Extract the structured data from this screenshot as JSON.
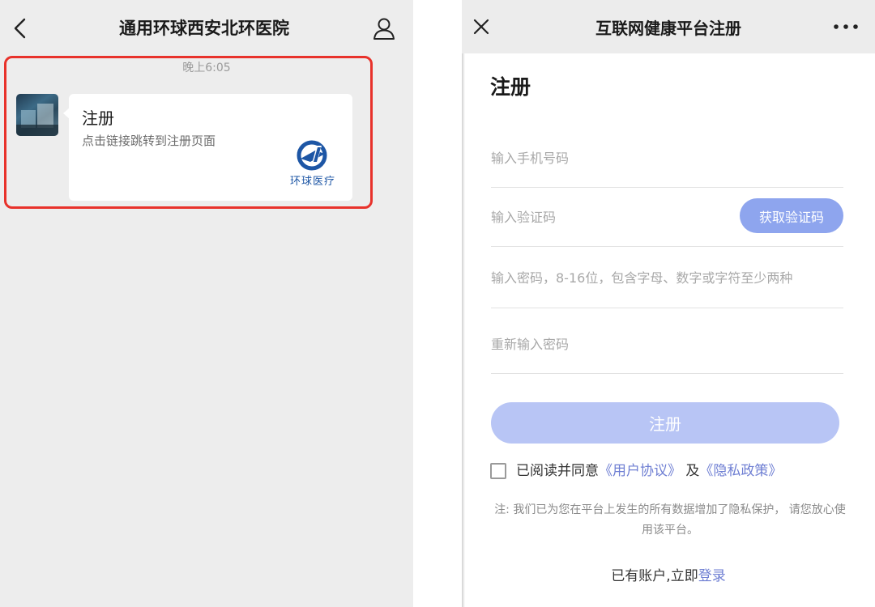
{
  "chat": {
    "header_title": "通用环球西安北环医院",
    "time": "晚上6:05",
    "card": {
      "title": "注册",
      "description": "点击链接跳转到注册页面",
      "logo_text": "环球医疗"
    }
  },
  "register": {
    "header_title": "互联网健康平台注册",
    "heading": "注册",
    "fields": {
      "phone_placeholder": "输入手机号码",
      "code_placeholder": "输入验证码",
      "password_placeholder": "输入密码，8-16位，包含字母、数字或字符至少两种",
      "confirm_placeholder": "重新输入密码"
    },
    "get_code_label": "获取验证码",
    "submit_label": "注册",
    "agreement": {
      "prefix": "已阅读并同意",
      "user_agreement": "《用户协议》",
      "conjunction": " 及",
      "privacy_policy": "《隐私政策》",
      "checked": false
    },
    "privacy_note": "注: 我们已为您在平台上发生的所有数据增加了隐私保护， 请您放心使用该平台。",
    "login_prompt": "已有账户,立即",
    "login_link": "登录"
  },
  "colors": {
    "highlight": "#e8322b",
    "accent": "#6f7fd3",
    "button_primary": "#8ea5ee",
    "button_disabled": "#b8c5f5",
    "logo_blue": "#1d56a5"
  },
  "icons": {
    "back": "chevron-left-icon",
    "profile": "user-icon",
    "close": "close-icon",
    "more": "more-dots-icon",
    "logo": "gh-logo-icon"
  }
}
